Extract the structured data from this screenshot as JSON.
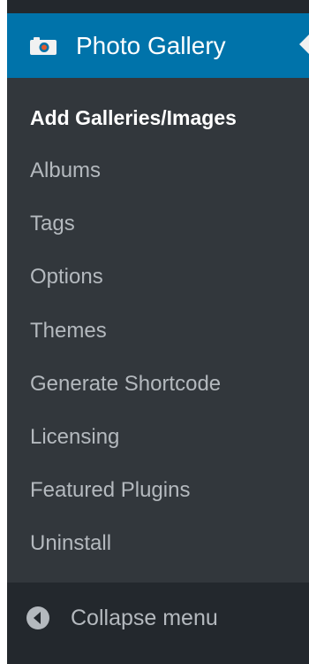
{
  "menu": {
    "header": {
      "label": "Photo Gallery",
      "icon": "camera-icon",
      "background": "#0073aa"
    },
    "submenu": [
      {
        "label": "Add Galleries/Images",
        "current": true
      },
      {
        "label": "Albums",
        "current": false
      },
      {
        "label": "Tags",
        "current": false
      },
      {
        "label": "Options",
        "current": false
      },
      {
        "label": "Themes",
        "current": false
      },
      {
        "label": "Generate Shortcode",
        "current": false
      },
      {
        "label": "Licensing",
        "current": false
      },
      {
        "label": "Featured Plugins",
        "current": false
      },
      {
        "label": "Uninstall",
        "current": false
      }
    ],
    "collapse": {
      "label": "Collapse menu",
      "icon": "collapse-arrow-icon"
    }
  },
  "colors": {
    "menu_background": "#23282d",
    "submenu_background": "#32373c",
    "text_muted": "#b4b9be",
    "text_current": "#ffffff"
  }
}
